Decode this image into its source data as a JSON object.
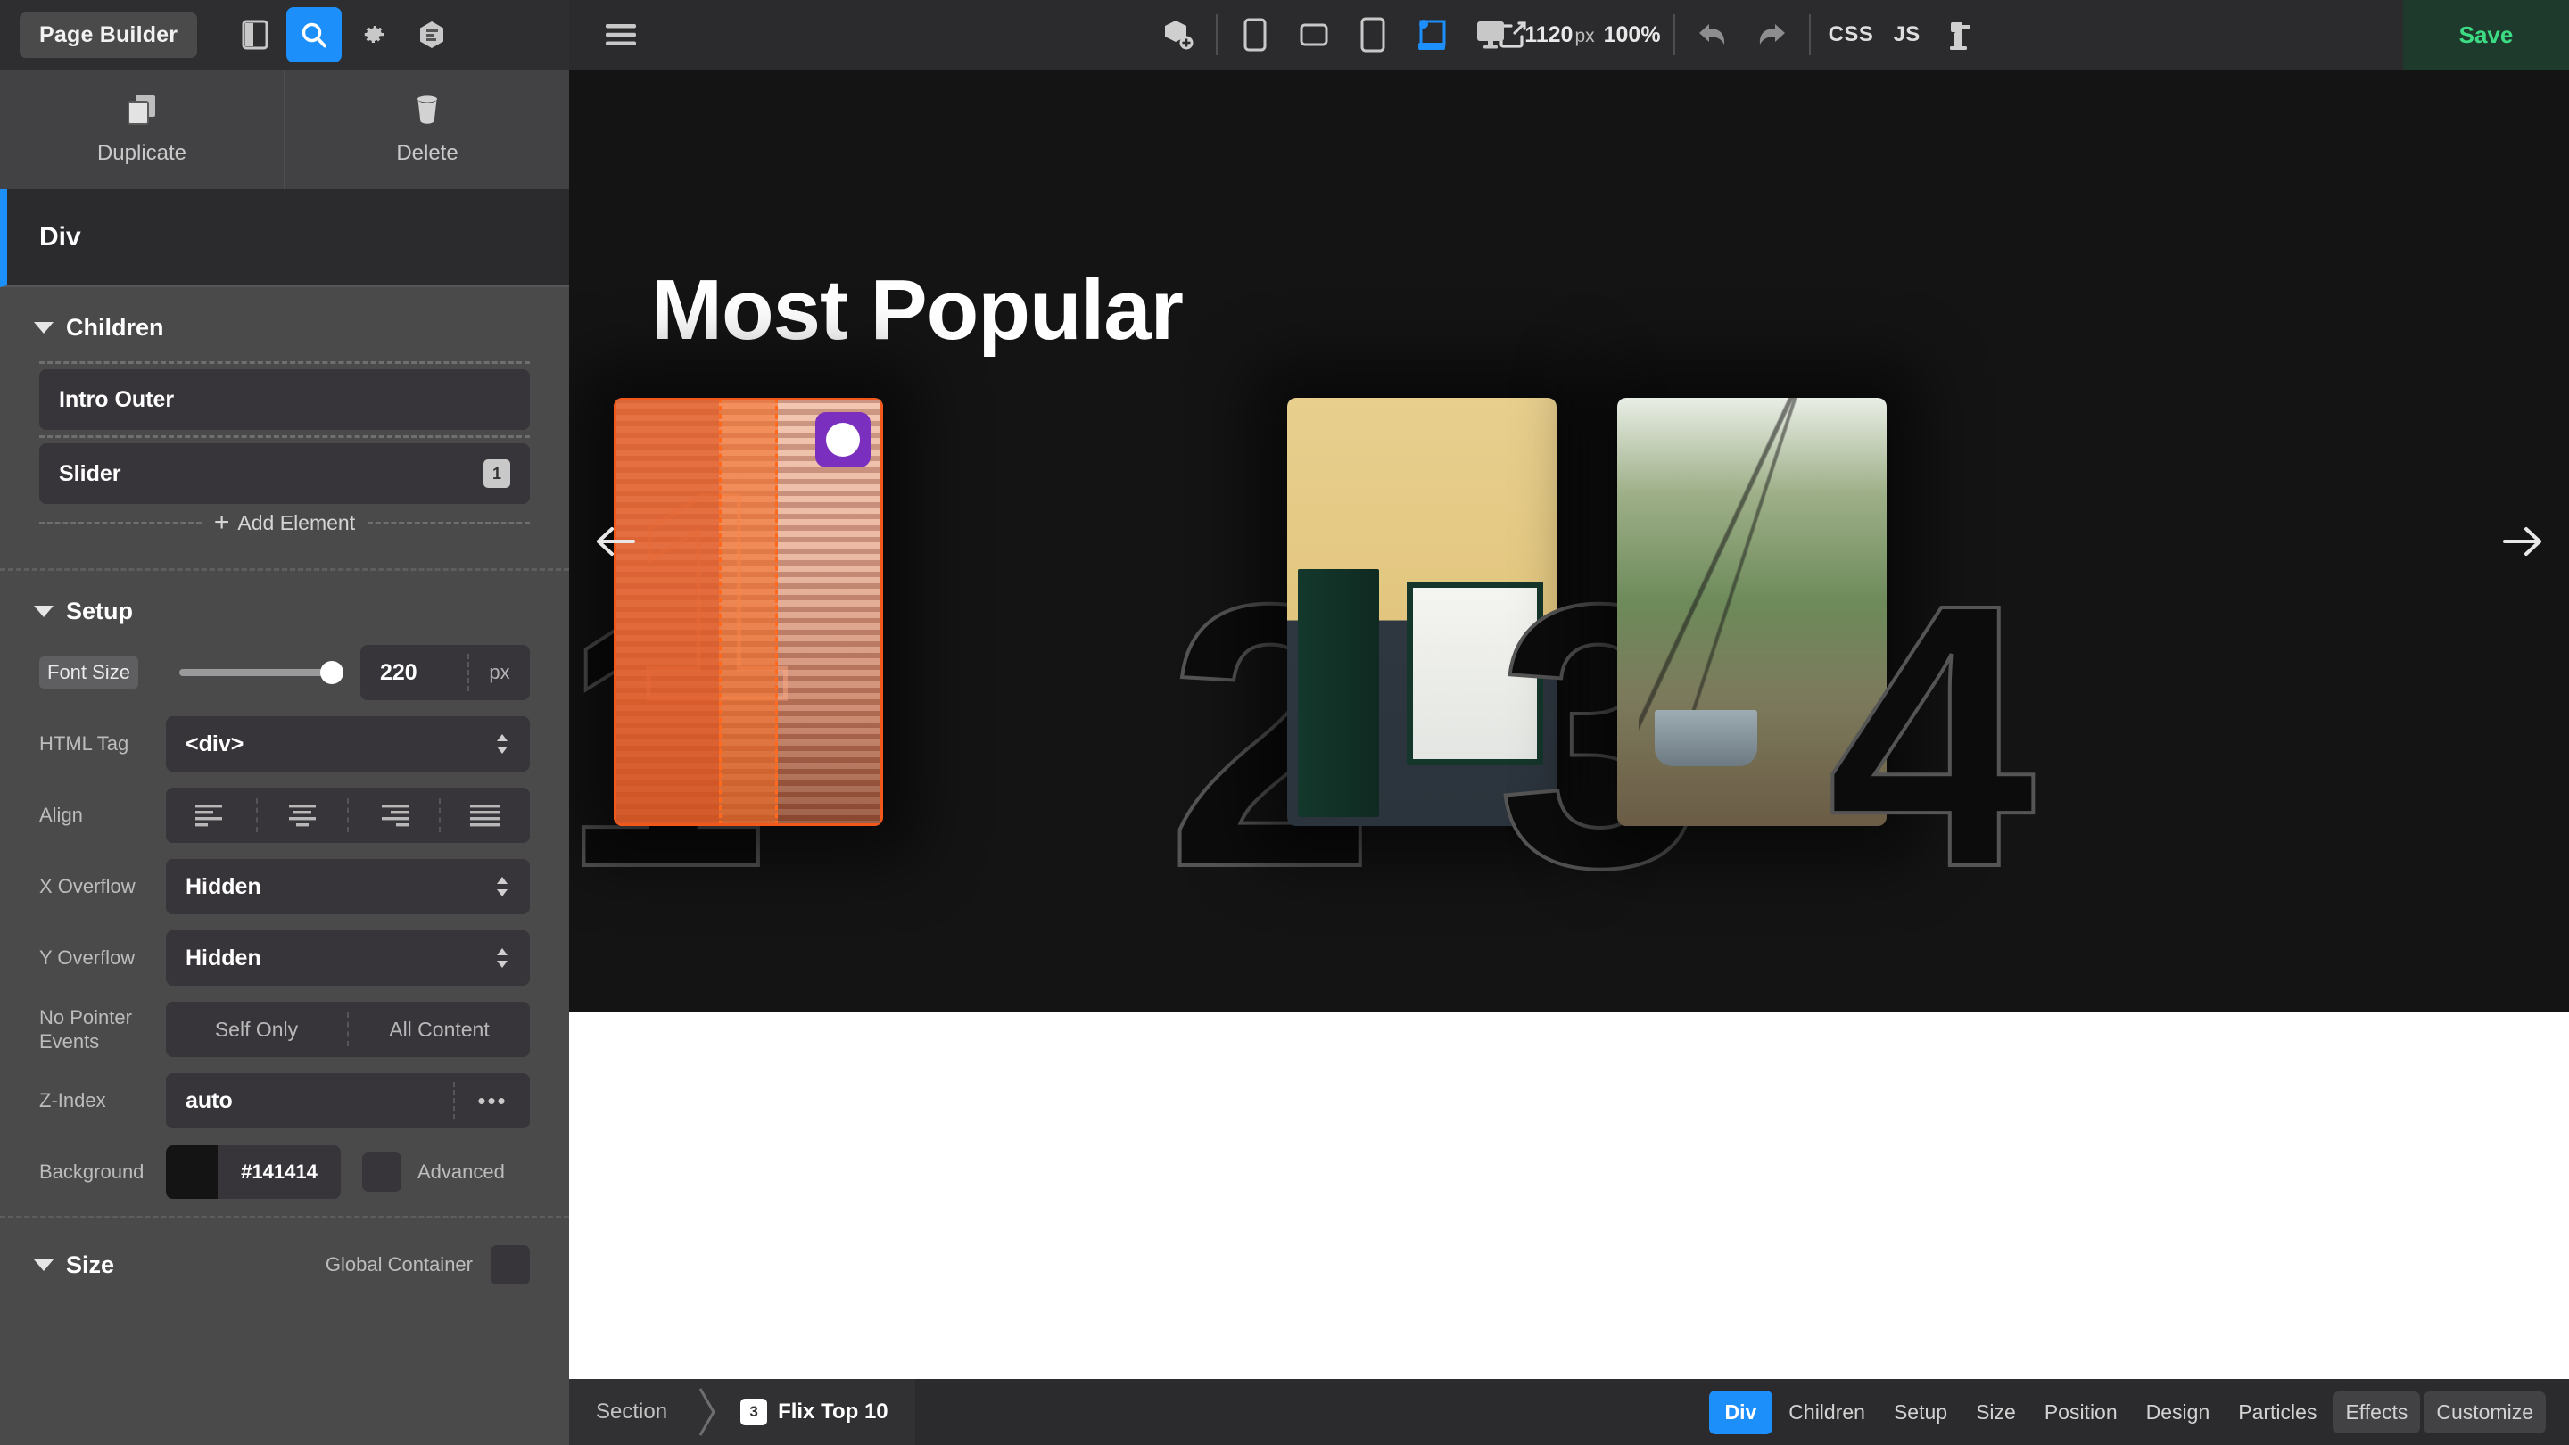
{
  "topbar": {
    "app_chip": "Page Builder",
    "left_icons": [
      {
        "name": "panel-toggle-icon",
        "active": false
      },
      {
        "name": "search-icon",
        "active": true
      },
      {
        "name": "settings-gear-icon",
        "active": false
      },
      {
        "name": "layers-icon",
        "active": false
      }
    ],
    "menu_icon": "hamburger-menu-icon",
    "add_element_icon": "add-block-icon",
    "devices": [
      {
        "name": "device-mobile",
        "active": false
      },
      {
        "name": "device-mobile-landscape",
        "active": false
      },
      {
        "name": "device-tablet",
        "active": false
      },
      {
        "name": "device-tablet-landscape",
        "active": true
      },
      {
        "name": "device-desktop",
        "active": false
      }
    ],
    "viewport_width": "1120",
    "viewport_unit": "px",
    "zoom_level": "100%",
    "undo_icon": "undo-arrow-icon",
    "redo_icon": "redo-arrow-icon",
    "css_label": "CSS",
    "js_label": "JS",
    "tools_icon": "drill-tool-icon",
    "preview_icon": "open-external-icon",
    "save_label": "Save",
    "accent_blue": "#1d8ffb",
    "save_green": "#3ddc84"
  },
  "panel": {
    "duplicate_label": "Duplicate",
    "delete_label": "Delete",
    "element_title": "Div",
    "children": {
      "title": "Children",
      "items": [
        {
          "label": "Intro Outer",
          "badge": ""
        },
        {
          "label": "Slider",
          "badge": "1"
        }
      ],
      "add_label": "Add Element"
    },
    "setup": {
      "title": "Setup",
      "font_size": {
        "label": "Font Size",
        "value": "220",
        "unit": "px"
      },
      "html_tag": {
        "label": "HTML Tag",
        "value": "<div>"
      },
      "align": {
        "label": "Align",
        "options": [
          "align-left-icon",
          "align-center-icon",
          "align-right-icon",
          "align-justify-icon"
        ]
      },
      "x_overflow": {
        "label": "X Overflow",
        "value": "Hidden"
      },
      "y_overflow": {
        "label": "Y Overflow",
        "value": "Hidden"
      },
      "no_pointer_events": {
        "label": "No Pointer Events",
        "options": [
          "Self Only",
          "All Content"
        ]
      },
      "z_index": {
        "label": "Z-Index",
        "value": "auto"
      },
      "background": {
        "label": "Background",
        "hex": "#141414",
        "advanced_label": "Advanced"
      }
    },
    "size": {
      "title": "Size",
      "global_container_label": "Global Container"
    }
  },
  "canvas": {
    "hero_title": "Most Popular",
    "background": "#141414",
    "prev_arrow": "arrow-left-icon",
    "next_arrow": "arrow-right-icon",
    "slides": [
      {
        "number": "1",
        "image": "orange-stairway-photo",
        "selected": true
      },
      {
        "number": "2",
        "image": "yellow-house-green-door-photo",
        "selected": false
      },
      {
        "number": "3",
        "image": "playground-swings-photo",
        "selected": false
      },
      {
        "number": "4",
        "image": "partial-photo",
        "selected": false
      }
    ],
    "cursor_badge": "hand-pointer-cursor-icon"
  },
  "bottombar": {
    "breadcrumb": [
      {
        "label": "Section",
        "badge": ""
      },
      {
        "label": "Flix Top 10",
        "badge": "3"
      }
    ],
    "tabs": [
      {
        "label": "Div",
        "style": "primary"
      },
      {
        "label": "Children",
        "style": "plain"
      },
      {
        "label": "Setup",
        "style": "plain"
      },
      {
        "label": "Size",
        "style": "plain"
      },
      {
        "label": "Position",
        "style": "plain"
      },
      {
        "label": "Design",
        "style": "plain"
      },
      {
        "label": "Particles",
        "style": "plain"
      },
      {
        "label": "Effects",
        "style": "boxed"
      },
      {
        "label": "Customize",
        "style": "boxed"
      }
    ]
  }
}
